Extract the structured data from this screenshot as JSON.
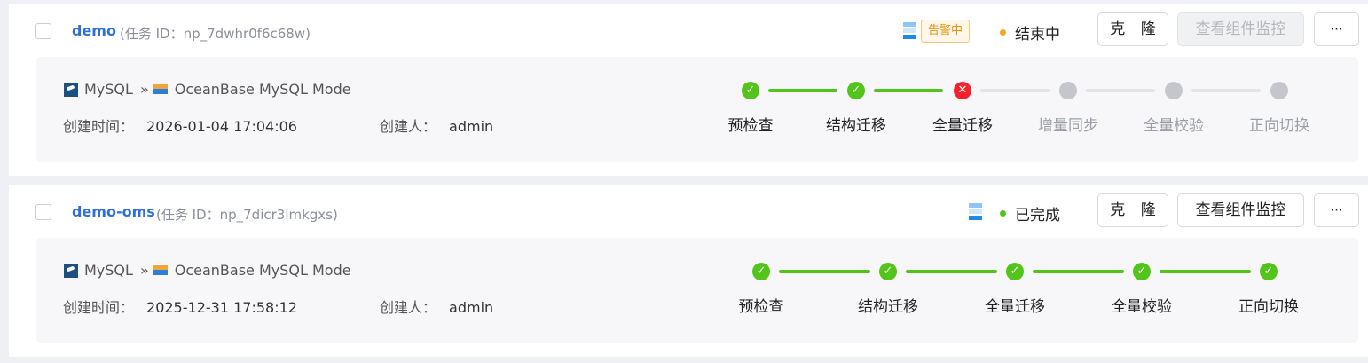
{
  "tasks": [
    {
      "name": "demo",
      "id_text": "(任务 ID：np_7dwhr0f6c68w)",
      "alert_badge": "告警中",
      "status": "结束中",
      "status_color": "#f5a623",
      "buttons": {
        "clone": "克 隆",
        "monitor": "查看组件监控",
        "more": "···"
      },
      "monitor_disabled": true,
      "source": "MySQL",
      "arrow": "»",
      "target": "OceanBase MySQL Mode",
      "created_label": "创建时间：",
      "created_value": "2026-01-04 17:04:06",
      "creator_label": "创建人：",
      "creator_value": "admin",
      "steps": [
        {
          "label": "预检查",
          "state": "done"
        },
        {
          "label": "结构迁移",
          "state": "done"
        },
        {
          "label": "全量迁移",
          "state": "error"
        },
        {
          "label": "增量同步",
          "state": "pending"
        },
        {
          "label": "全量校验",
          "state": "pending"
        },
        {
          "label": "正向切换",
          "state": "pending"
        }
      ]
    },
    {
      "name": "demo-oms",
      "id_text": "(任务 ID：np_7dicr3lmkgxs)",
      "status": "已完成",
      "status_color": "#52c41a",
      "buttons": {
        "clone": "克 隆",
        "monitor": "查看组件监控",
        "more": "···"
      },
      "monitor_disabled": false,
      "source": "MySQL",
      "arrow": "»",
      "target": "OceanBase MySQL Mode",
      "created_label": "创建时间：",
      "created_value": "2025-12-31 17:58:12",
      "creator_label": "创建人：",
      "creator_value": "admin",
      "steps": [
        {
          "label": "预检查",
          "state": "done"
        },
        {
          "label": "结构迁移",
          "state": "done"
        },
        {
          "label": "全量迁移",
          "state": "done"
        },
        {
          "label": "全量校验",
          "state": "done"
        },
        {
          "label": "正向切换",
          "state": "done"
        }
      ]
    }
  ],
  "icons": {
    "check": "✓",
    "cross": "✕"
  }
}
